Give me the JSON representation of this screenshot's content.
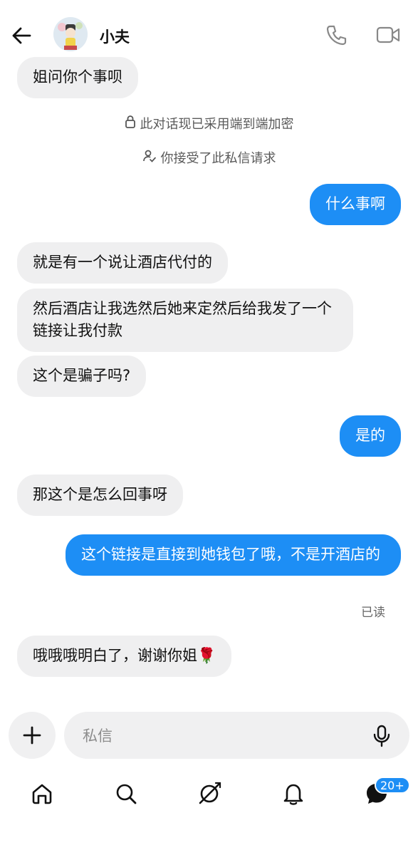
{
  "header": {
    "contact_name": "小夫"
  },
  "system_notices": {
    "encryption": "此对话现已采用端到端加密",
    "accepted": "你接受了此私信请求"
  },
  "messages": [
    {
      "from": "them",
      "text": "姐问你个事呗"
    },
    {
      "from": "me",
      "text": "什么事啊"
    },
    {
      "from": "them",
      "text": "就是有一个说让酒店代付的"
    },
    {
      "from": "them",
      "text": "然后酒店让我选然后她来定然后给我发了一个链接让我付款"
    },
    {
      "from": "them",
      "text": "这个是骗子吗?"
    },
    {
      "from": "me",
      "text": "是的"
    },
    {
      "from": "them",
      "text": "那这个是怎么回事呀"
    },
    {
      "from": "me",
      "text": "这个链接是直接到她钱包了哦，不是开酒店的"
    },
    {
      "from": "them",
      "text": "哦哦哦明白了，谢谢你姐🌹"
    }
  ],
  "read_status": "已读",
  "composer": {
    "placeholder": "私信"
  },
  "nav": {
    "items": [
      "home-icon",
      "search-icon",
      "explore-icon",
      "notifications-icon",
      "messages-icon"
    ],
    "messages_badge": "20+"
  },
  "colors": {
    "outgoing_bubble": "#1d8ef5",
    "incoming_bubble": "#efeff0",
    "badge": "#1d8ef5"
  }
}
